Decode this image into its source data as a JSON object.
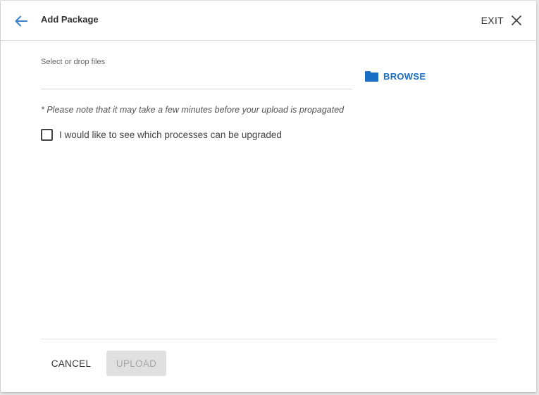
{
  "header": {
    "title": "Add Package",
    "back_icon": "arrow-left-icon",
    "exit_label": "EXIT",
    "exit_icon": "close-icon"
  },
  "upload": {
    "field_label": "Select or drop files",
    "input_value": "",
    "browse_label": "BROWSE",
    "browse_icon": "folder-icon",
    "note": "* Please note that it may take a few minutes before your upload is propagated"
  },
  "options": {
    "checkbox_label": "I would like to see which processes can be upgraded",
    "checked": false
  },
  "footer": {
    "cancel_label": "CANCEL",
    "upload_label": "UPLOAD",
    "upload_disabled": true
  },
  "colors": {
    "accent": "#1a6fc4",
    "back_arrow": "#3b83c9",
    "disabled_bg": "#e0e0e0",
    "disabled_text": "#a6a6a6"
  }
}
